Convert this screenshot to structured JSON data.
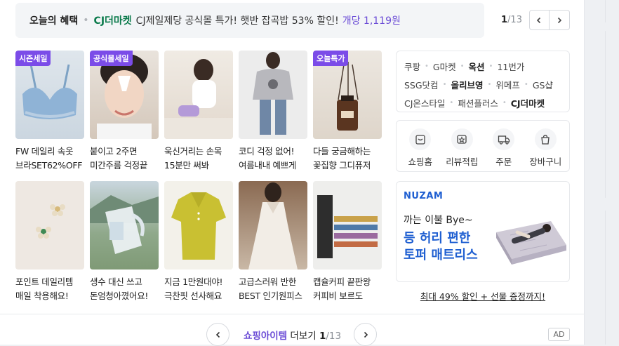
{
  "banner": {
    "label": "오늘의 혜택",
    "brand": "CJ더마켓",
    "description": "CJ제일제당 공식몰 특가! 햇반 잡곡밥 53% 할인!",
    "price": "개당 1,119원"
  },
  "pager_top": {
    "current": "1",
    "total": "/13"
  },
  "products": [
    {
      "tag": "시즌세일",
      "line1": "FW 데일리 속옷",
      "line2": "브라SET62%OFF"
    },
    {
      "tag": "공식몰세일",
      "line1": "붙이고 2주면",
      "line2": "미간주름 걱정끝"
    },
    {
      "tag": "",
      "line1": "욱신거리는 손목",
      "line2": "15분만 써봐"
    },
    {
      "tag": "",
      "line1": "코디 걱정 없어!",
      "line2": "여름내내 예쁘게"
    },
    {
      "tag": "오늘특가",
      "line1": "다들 궁금해하는",
      "line2": "꽃집향 그디퓨저"
    },
    {
      "tag": "",
      "line1": "포인트 데일리템",
      "line2": "매일 착용해요!"
    },
    {
      "tag": "",
      "line1": "생수 대신 쓰고",
      "line2": "돈엄청아꼈어요!"
    },
    {
      "tag": "",
      "line1": "지금 1만원대야!",
      "line2": "극찬핏 선사해요"
    },
    {
      "tag": "",
      "line1": "고급스러워 반한",
      "line2": "BEST 인기원피스"
    },
    {
      "tag": "",
      "line1": "캡슐커피 끝판왕",
      "line2": "커피비 보르도"
    }
  ],
  "shops": {
    "row1": [
      "쿠팡",
      "G마켓",
      "옥션",
      "11번가"
    ],
    "row2": [
      "SSG닷컴",
      "올리브영",
      "위메프",
      "GS샵"
    ],
    "row3": [
      "CJ온스타일",
      "패션플러스",
      "CJ더마켓"
    ]
  },
  "menu": [
    {
      "label": "쇼핑홈",
      "icon": "shopping-home-icon"
    },
    {
      "label": "리뷰적립",
      "icon": "review-reward-icon"
    },
    {
      "label": "주문",
      "icon": "delivery-truck-icon"
    },
    {
      "label": "장바구니",
      "icon": "shopping-bag-icon"
    }
  ],
  "ad": {
    "brand": "NUZAM",
    "line1": "까는 이불 Bye~",
    "line2": "등 허리 편한",
    "line3": "토퍼 매트리스",
    "link": "최대 49% 할인 + 선물 증정까지!"
  },
  "footer": {
    "more_highlight": "쇼핑아이템",
    "more_text": " 더보기 ",
    "current": "1",
    "total": "/13",
    "ad_badge": "AD"
  },
  "colors": {
    "accent": "#6b4cd6",
    "tag": "#7b4ce8",
    "brand_green": "#0a7a4b",
    "ad_blue": "#1f5fd1"
  }
}
